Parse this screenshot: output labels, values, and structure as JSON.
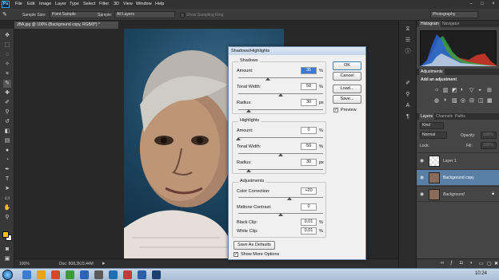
{
  "app": {
    "logo": "Ps",
    "menu": [
      "File",
      "Edit",
      "Image",
      "Layer",
      "Type",
      "Select",
      "Filter",
      "3D",
      "View",
      "Window",
      "Help"
    ],
    "window_controls": [
      "–",
      "□",
      "×"
    ]
  },
  "options_bar": {
    "sample_size_label": "Sample Size:",
    "sample_size_value": "Point Sample",
    "sample_label": "Sample:",
    "sample_value": "All Layers",
    "show_ring_label": "Show Sampling Ring",
    "workspace": "Photography"
  },
  "document": {
    "tab_title": "JBA.jpg @ 100% (Background copy, RGB/8*) *",
    "zoom": "100%",
    "doc_info": "Doc: 808,2K/3,44M"
  },
  "dialog": {
    "title": "Shadows/Highlights",
    "shadows": {
      "label": "Shadows",
      "amount_label": "Amount:",
      "amount_value": "35",
      "amount_unit": "%",
      "amount_level": 0.35,
      "tonal_label": "Tonal Width:",
      "tonal_value": "50",
      "tonal_unit": "%",
      "tonal_level": 0.5,
      "radius_label": "Radius:",
      "radius_value": "30",
      "radius_unit": "px",
      "radius_level": 0.12
    },
    "highlights": {
      "label": "Highlights",
      "amount_label": "Amount:",
      "amount_value": "0",
      "amount_unit": "%",
      "amount_level": 0.0,
      "tonal_label": "Tonal Width:",
      "tonal_value": "50",
      "tonal_unit": "%",
      "tonal_level": 0.5,
      "radius_label": "Radius:",
      "radius_value": "30",
      "radius_unit": "px",
      "radius_level": 0.12
    },
    "adjustments": {
      "label": "Adjustments",
      "color_label": "Color Correction:",
      "color_value": "+20",
      "color_level": 0.6,
      "midtone_label": "Midtone Contrast:",
      "midtone_value": "0",
      "midtone_level": 0.5,
      "black_label": "Black Clip:",
      "black_value": "0,01",
      "black_unit": "%",
      "white_label": "White Clip:",
      "white_value": "0,01",
      "white_unit": "%"
    },
    "buttons": {
      "ok": "OK",
      "cancel": "Cancel",
      "load": "Load...",
      "save": "Save..."
    },
    "preview_label": "Preview",
    "save_defaults": "Save As Defaults",
    "show_more": "Show More Options"
  },
  "panels": {
    "histogram_tabs": [
      "Histogram",
      "Navigator"
    ],
    "adjustments_tab": "Adjustments",
    "add_adjustment": "Add an adjustment",
    "layers_tabs": [
      "Layers",
      "Channels",
      "Paths"
    ],
    "kind_label": "Kind",
    "blend_mode": "Normal",
    "opacity_label": "Opacity:",
    "opacity_value": "100%",
    "lock_label": "Lock:",
    "fill_label": "Fill:",
    "fill_value": "100%",
    "layers": [
      "Layer 1",
      "Background copy",
      "Background"
    ]
  },
  "taskbar": {
    "time": "10:24",
    "icon_colors": [
      "#3a7bd5",
      "#e8a317",
      "#d9472b",
      "#3c9a3c",
      "#2a63b8",
      "#5a5a5a",
      "#1f6fb5",
      "#c23b3b",
      "#2b5faa",
      "#1c3f70"
    ]
  },
  "colors": {
    "dialog_bg": "#f0f0f0",
    "app_dark": "#282828",
    "selected_layer": "#5a7fa6"
  }
}
